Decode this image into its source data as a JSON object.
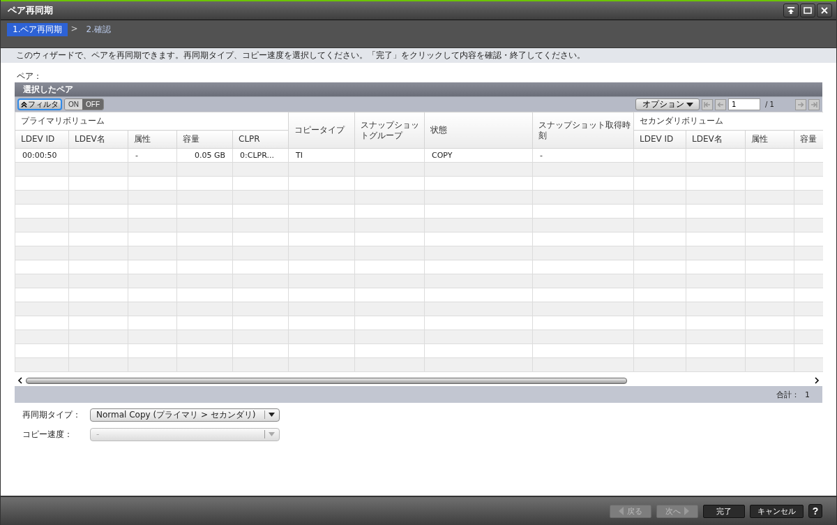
{
  "window": {
    "title": "ペア再同期"
  },
  "wizard": {
    "separator": ">",
    "steps": [
      {
        "label": "1.ペア再同期",
        "selected": true
      },
      {
        "label": "2.確認",
        "selected": false
      }
    ]
  },
  "description": "このウィザードで、ペアを再同期できます。再同期タイプ、コピー速度を選択してください。「完了」をクリックして内容を確認・終了してください。",
  "pair_label": "ペア：",
  "panel": {
    "title": "選択したペア",
    "filter_button": "フィルタ",
    "filter_toggle": [
      {
        "label": "ON",
        "selected": false
      },
      {
        "label": "OFF",
        "selected": true
      }
    ],
    "options_button": "オプション",
    "page": "1",
    "page_total": "/ 1",
    "column_groups": [
      {
        "label": "プライマリボリューム",
        "columns": [
          {
            "label": "LDEV ID"
          },
          {
            "label": "LDEV名"
          },
          {
            "label": "属性"
          },
          {
            "label": "容量"
          },
          {
            "label": "CLPR"
          }
        ]
      },
      {
        "label": "コピータイプ"
      },
      {
        "label": "スナップショットグループ"
      },
      {
        "label": "状態"
      },
      {
        "label": "スナップショット取得時刻"
      },
      {
        "label": "セカンダリボリューム",
        "columns": [
          {
            "label": "LDEV ID"
          },
          {
            "label": "LDEV名"
          },
          {
            "label": "属性"
          },
          {
            "label": "容量"
          }
        ]
      }
    ],
    "rows": [
      [
        "00:00:50",
        null,
        "-",
        "0.05 GB",
        "0:CLPR...",
        "TI",
        null,
        "COPY",
        "-",
        null,
        null,
        null,
        null
      ]
    ],
    "total_label": "合計：",
    "total_value": "1"
  },
  "fields": [
    {
      "label": "再同期タイプ：",
      "value": "Normal Copy (プライマリ > セカンダリ)",
      "disabled": false
    },
    {
      "label": "コピー速度：",
      "value": "-",
      "disabled": true
    }
  ],
  "buttons": [
    {
      "label": "戻る",
      "kind": "back",
      "disabled": true
    },
    {
      "label": "次へ",
      "kind": "next",
      "disabled": true
    },
    {
      "label": "完了",
      "kind": "plain",
      "disabled": false
    },
    {
      "label": "キャンセル",
      "kind": "plain",
      "disabled": false
    }
  ],
  "help": "?"
}
